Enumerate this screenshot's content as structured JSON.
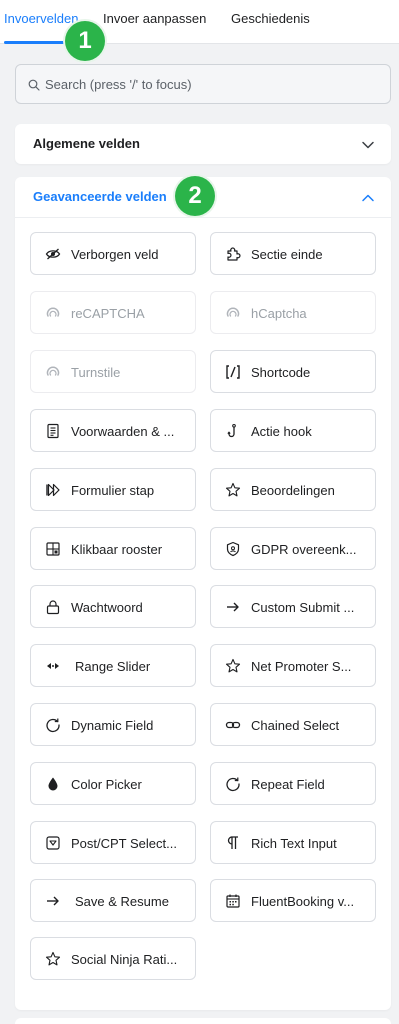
{
  "tabs": [
    {
      "label": "Invoervelden",
      "active": true
    },
    {
      "label": "Invoer aanpassen",
      "active": false
    },
    {
      "label": "Geschiedenis",
      "active": false
    }
  ],
  "badges": [
    "1",
    "2"
  ],
  "search": {
    "placeholder": "Search (press '/' to focus)",
    "value": ""
  },
  "panels": {
    "general": {
      "title": "Algemene velden",
      "expanded": false
    },
    "advanced": {
      "title": "Geavanceerde velden",
      "expanded": true
    }
  },
  "fields": [
    {
      "label": "Verborgen veld",
      "icon": "eye-slash-icon"
    },
    {
      "label": "Sectie einde",
      "icon": "puzzle-icon"
    },
    {
      "label": "reCAPTCHA",
      "icon": "recaptcha-icon",
      "disabled": true
    },
    {
      "label": "hCaptcha",
      "icon": "hcaptcha-icon",
      "disabled": true
    },
    {
      "label": "Turnstile",
      "icon": "turnstile-icon",
      "disabled": true
    },
    {
      "label": "Shortcode",
      "icon": "shortcode-icon"
    },
    {
      "label": "Voorwaarden & ...",
      "icon": "terms-document-icon"
    },
    {
      "label": "Actie hook",
      "icon": "hook-icon"
    },
    {
      "label": "Formulier stap",
      "icon": "step-forward-icon"
    },
    {
      "label": "Beoordelingen",
      "icon": "star-icon"
    },
    {
      "label": "Klikbaar rooster",
      "icon": "grid-icon"
    },
    {
      "label": "GDPR overeenk...",
      "icon": "shield-icon"
    },
    {
      "label": "Wachtwoord",
      "icon": "lock-icon"
    },
    {
      "label": "Custom Submit ...",
      "icon": "arrow-right-icon"
    },
    {
      "label": "Range Slider",
      "icon": "range-slider-icon"
    },
    {
      "label": "Net Promoter S...",
      "icon": "star-icon"
    },
    {
      "label": "Dynamic Field",
      "icon": "refresh-icon"
    },
    {
      "label": "Chained Select",
      "icon": "link-icon"
    },
    {
      "label": "Color Picker",
      "icon": "droplet-icon"
    },
    {
      "label": "Repeat Field",
      "icon": "refresh-icon"
    },
    {
      "label": "Post/CPT Select...",
      "icon": "post-select-icon"
    },
    {
      "label": "Rich Text Input",
      "icon": "paragraph-icon"
    },
    {
      "label": "Save & Resume",
      "icon": "arrow-right-icon"
    },
    {
      "label": "FluentBooking v...",
      "icon": "calendar-icon"
    },
    {
      "label": "Social Ninja Rati...",
      "icon": "star-icon"
    }
  ],
  "colors": {
    "accent": "#1a7efb",
    "badge": "#2bb44a",
    "background": "#f1f2f4"
  }
}
